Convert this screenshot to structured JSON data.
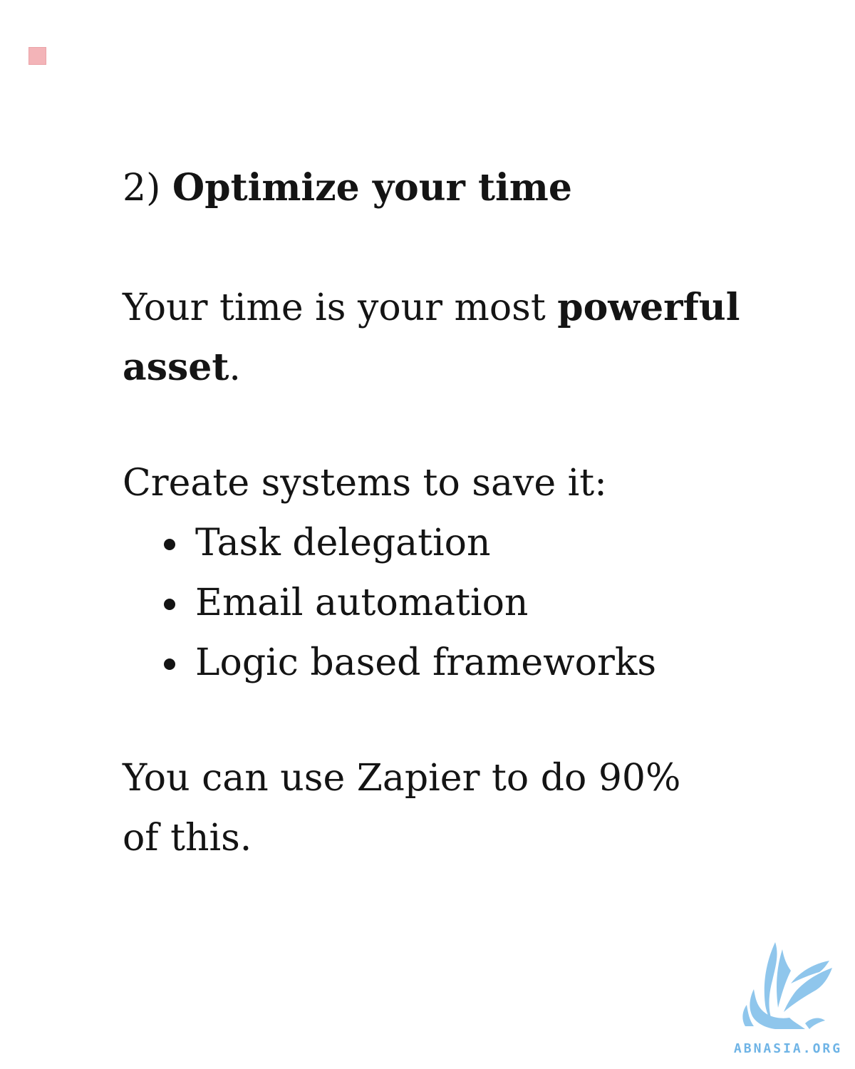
{
  "heading": {
    "number": "2)",
    "title": "Optimize your time"
  },
  "paragraph1": {
    "text_start": "Your time is your most ",
    "bold_word": "powerful",
    "newline_bold": "asset",
    "end": "."
  },
  "paragraph2": {
    "intro": "Create systems to save it:",
    "items": [
      "Task delegation",
      "Email automation",
      "Logic based frameworks"
    ]
  },
  "paragraph3": {
    "text": "You can use Zapier to do 90% of this."
  },
  "watermark": {
    "text": "ABNASIA.ORG",
    "color": "#6fb4e6"
  },
  "colors": {
    "corner_mark": "#f3b4b8",
    "text": "#141414"
  }
}
